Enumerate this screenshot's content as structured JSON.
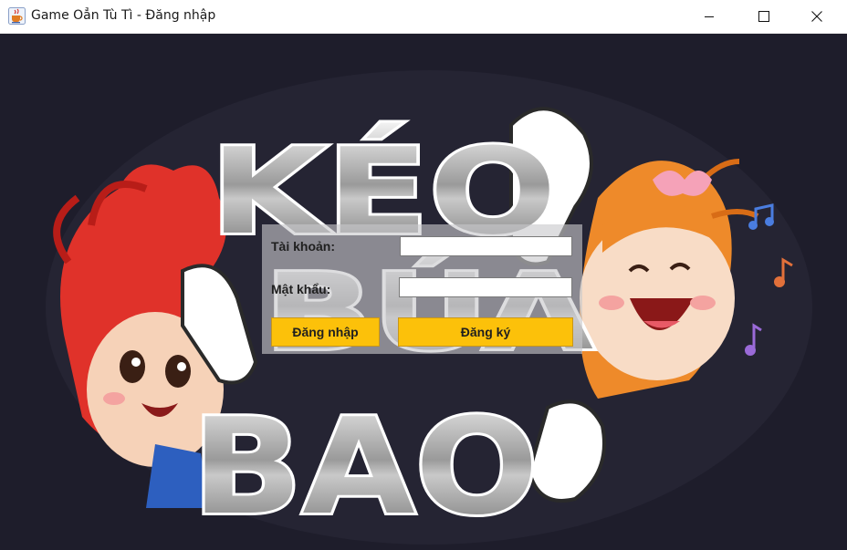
{
  "window": {
    "title": "Game Oẳn Tù Tì - Đăng nhập",
    "icon": "java-cup-icon",
    "controls": [
      "minimize-icon",
      "maximize-icon",
      "close-icon"
    ]
  },
  "background": {
    "logo_lines": [
      "KÉO",
      "BÚA",
      "BAO"
    ]
  },
  "login": {
    "username_label": "Tài khoản:",
    "username_value": "",
    "password_label": "Mật khẩu:",
    "password_value": "",
    "login_button": "Đăng nhập",
    "register_button": "Đăng ký"
  },
  "colors": {
    "background": "#1e1d2b",
    "button": "#fcc10a",
    "panel": "#c8c8cc"
  }
}
